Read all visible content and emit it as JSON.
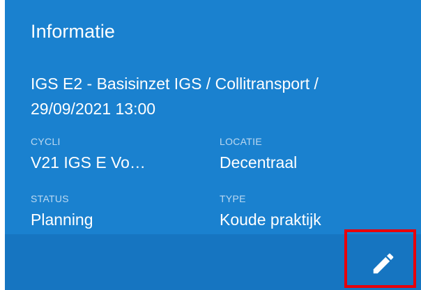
{
  "card": {
    "title": "Informatie",
    "subtitle": "IGS E2 - Basisinzet IGS / Collitransport / 29/09/2021 13:00",
    "fields": [
      {
        "label": "CYCLI",
        "value": "V21 IGS E Vo…"
      },
      {
        "label": "LOCATIE",
        "value": "Decentraal"
      },
      {
        "label": "STATUS",
        "value": "Planning"
      },
      {
        "label": "TYPE",
        "value": "Koude praktijk"
      }
    ],
    "edit_icon": "pencil-icon"
  },
  "colors": {
    "card_background": "#1a81cf",
    "footer_background": "#1675c1",
    "highlight_border": "#e8000b",
    "text": "#ffffff"
  }
}
